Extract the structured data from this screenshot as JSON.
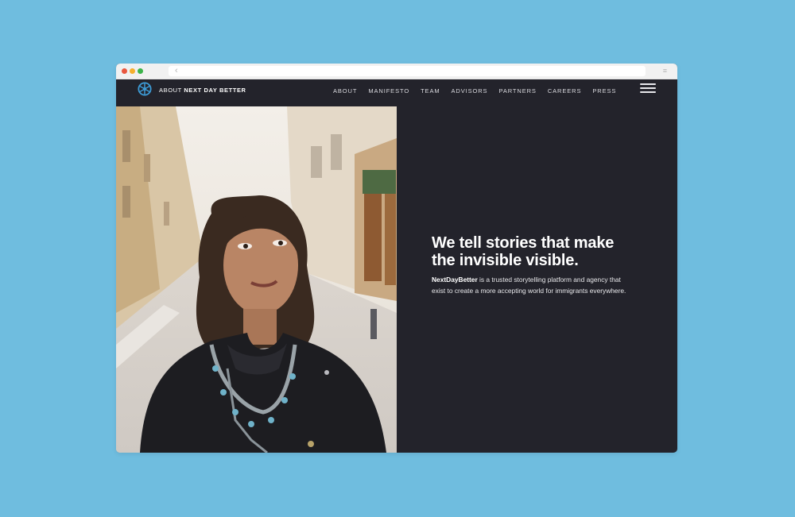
{
  "page": {
    "background_color": "#6fbddf"
  },
  "browser": {
    "window_buttons": [
      "close",
      "minimize",
      "maximize"
    ],
    "back_icon": "‹",
    "menu_icon": "≡"
  },
  "navbar": {
    "logo_icon": "reel-logo-icon",
    "brand_prefix": "ABOUT ",
    "brand_name": "NEXT DAY BETTER",
    "links": [
      "ABOUT",
      "MANIFESTO",
      "TEAM",
      "ADVISORS",
      "PARTNERS",
      "CAREERS",
      "PRESS"
    ],
    "menu_icon": "hamburger-icon"
  },
  "hero": {
    "photo_alt": "",
    "headline_line1": "We tell stories that make",
    "headline_line2": "the invisible visible.",
    "body_bold": "NextDayBetter",
    "body_rest_line1": " is a trusted storytelling platform and agency that",
    "body_line2": "exist to create a more accepting world for immigrants everywhere.",
    "panel_color": "#23232b"
  }
}
